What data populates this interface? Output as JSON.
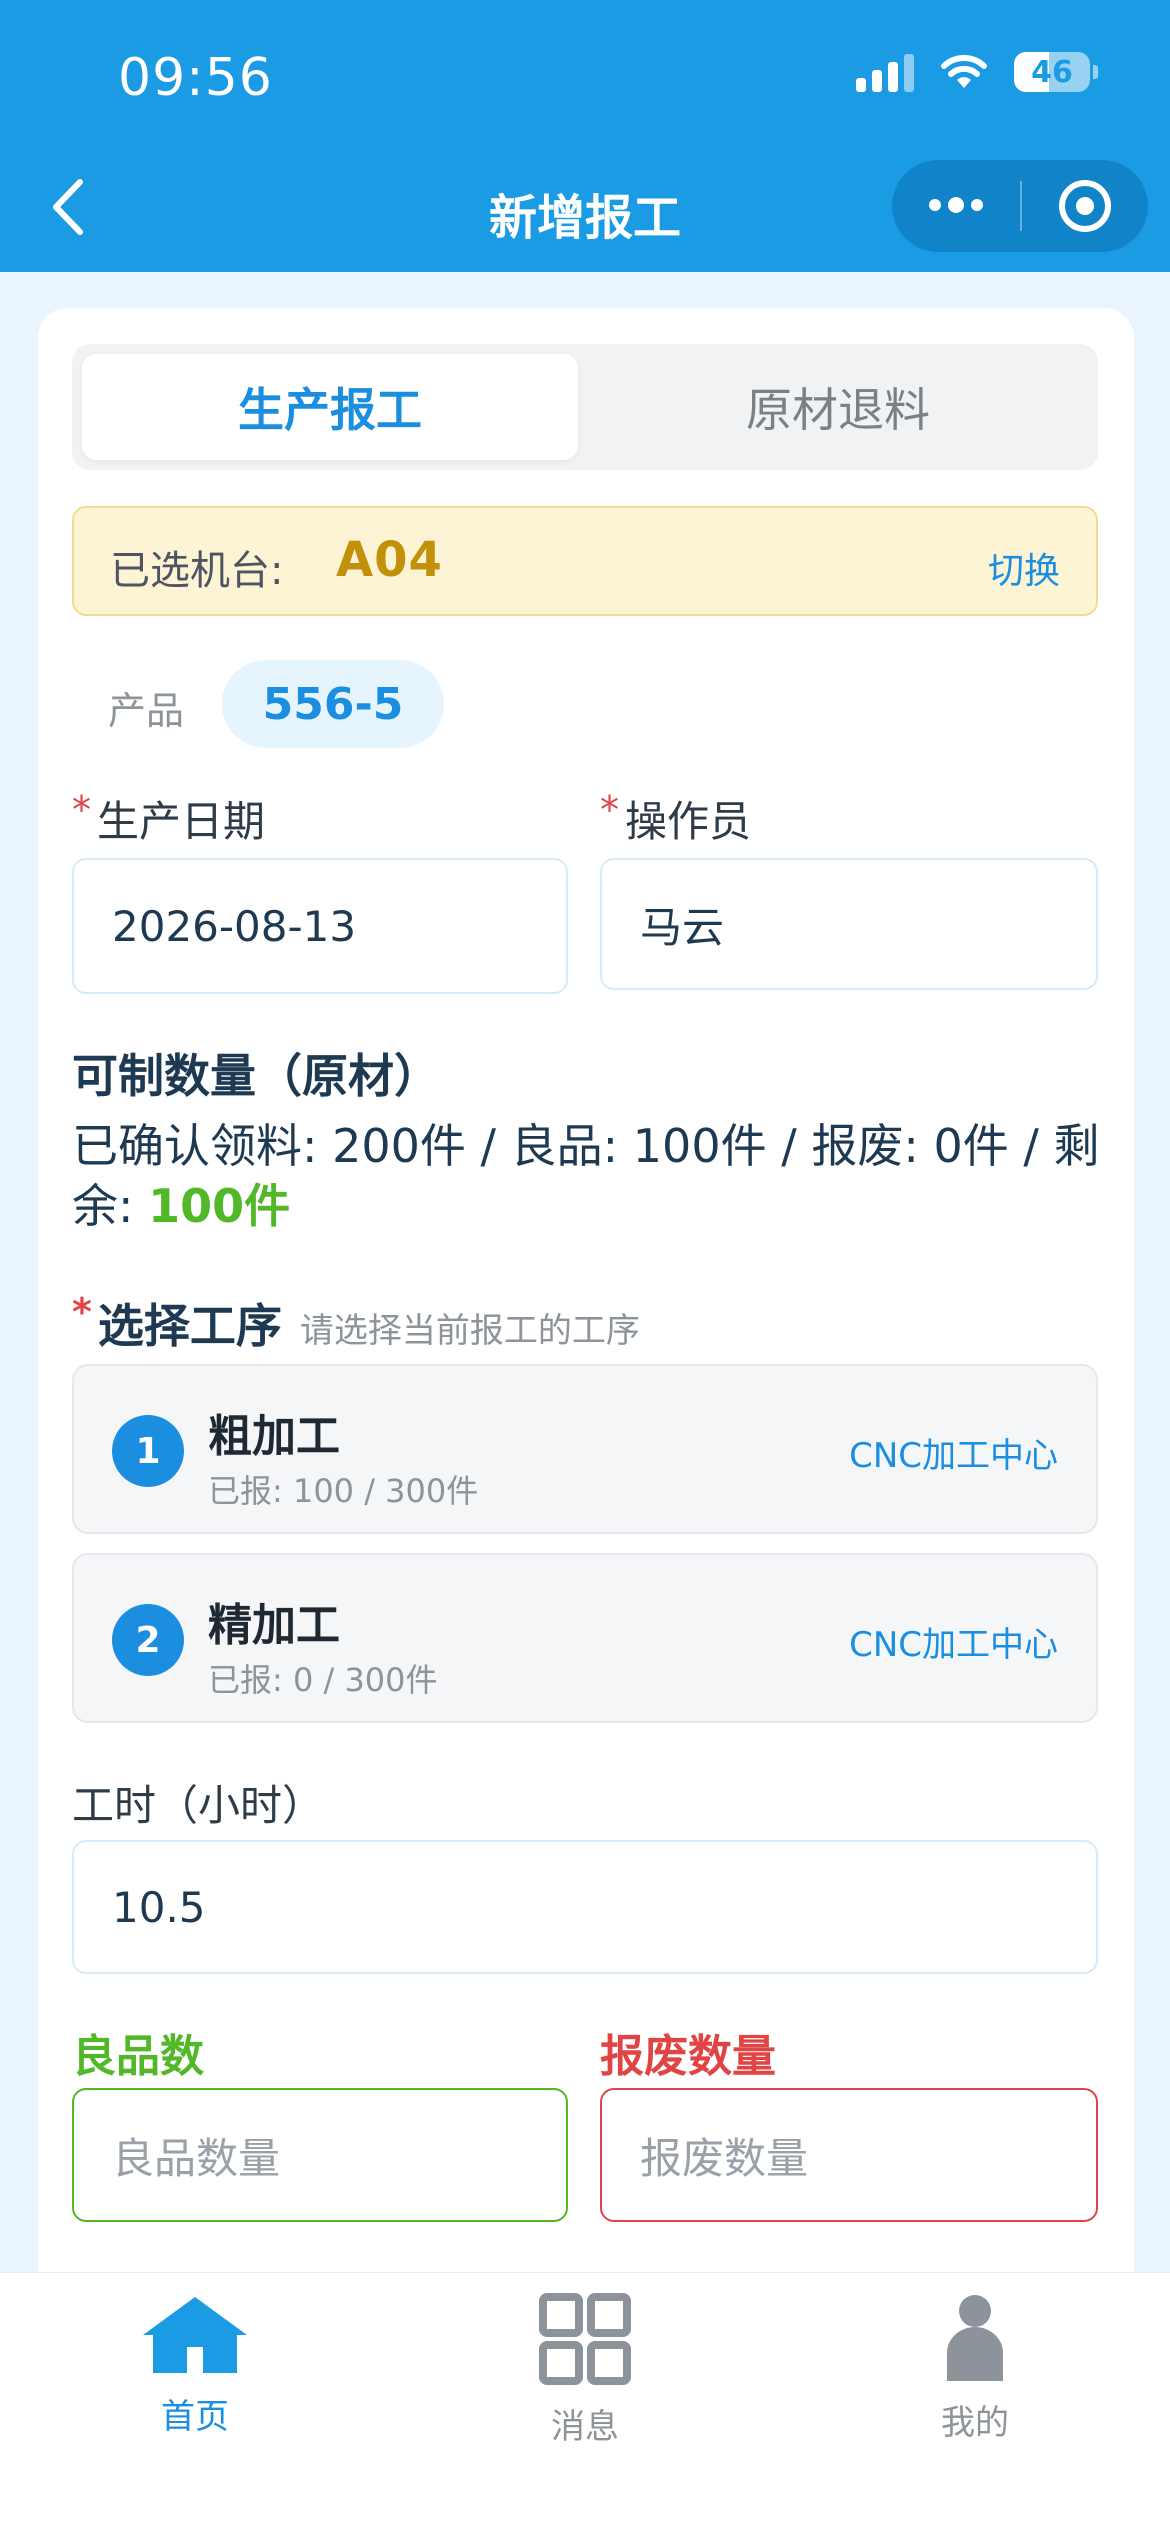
{
  "status_bar": {
    "time": "09:56",
    "battery": "46"
  },
  "nav": {
    "title": "新增报工"
  },
  "tabs": [
    {
      "label": "生产报工",
      "active": true
    },
    {
      "label": "原材退料",
      "active": false
    }
  ],
  "machine": {
    "label": "已选机台:",
    "value": "A04",
    "switch_label": "切换"
  },
  "product": {
    "label": "产品",
    "value": "556-5"
  },
  "production_date": {
    "required_mark": "*",
    "label": "生产日期",
    "value": "2026-08-13"
  },
  "operator": {
    "required_mark": "*",
    "label": "操作员",
    "value": "马云"
  },
  "quantity": {
    "title": "可制数量（原材）",
    "summary": "已确认领料: 200件 / 良品: 100件 / 报废: 0件 / 剩余: ",
    "remaining": "100件"
  },
  "process": {
    "required_mark": "*",
    "title": "选择工序",
    "hint": "请选择当前报工的工序",
    "items": [
      {
        "num": "1",
        "name": "粗加工",
        "reported": "已报: 100 / 300件",
        "machine": "CNC加工中心"
      },
      {
        "num": "2",
        "name": "精加工",
        "reported": "已报: 0 / 300件",
        "machine": "CNC加工中心"
      }
    ]
  },
  "hours": {
    "label": "工时（小时）",
    "value": "10.5"
  },
  "good": {
    "label": "良品数",
    "placeholder": "良品数量"
  },
  "scrap": {
    "label": "报废数量",
    "placeholder": "报废数量"
  },
  "tabbar": [
    {
      "label": "首页",
      "icon": "home-icon",
      "active": true
    },
    {
      "label": "消息",
      "icon": "grid-icon",
      "active": false
    },
    {
      "label": "我的",
      "icon": "user-icon",
      "active": false
    }
  ],
  "colors": {
    "primary": "#1b9be3",
    "accent": "#1b8ee0",
    "good": "#52b82a",
    "scrap": "#e04444",
    "machine": "#c39009"
  }
}
